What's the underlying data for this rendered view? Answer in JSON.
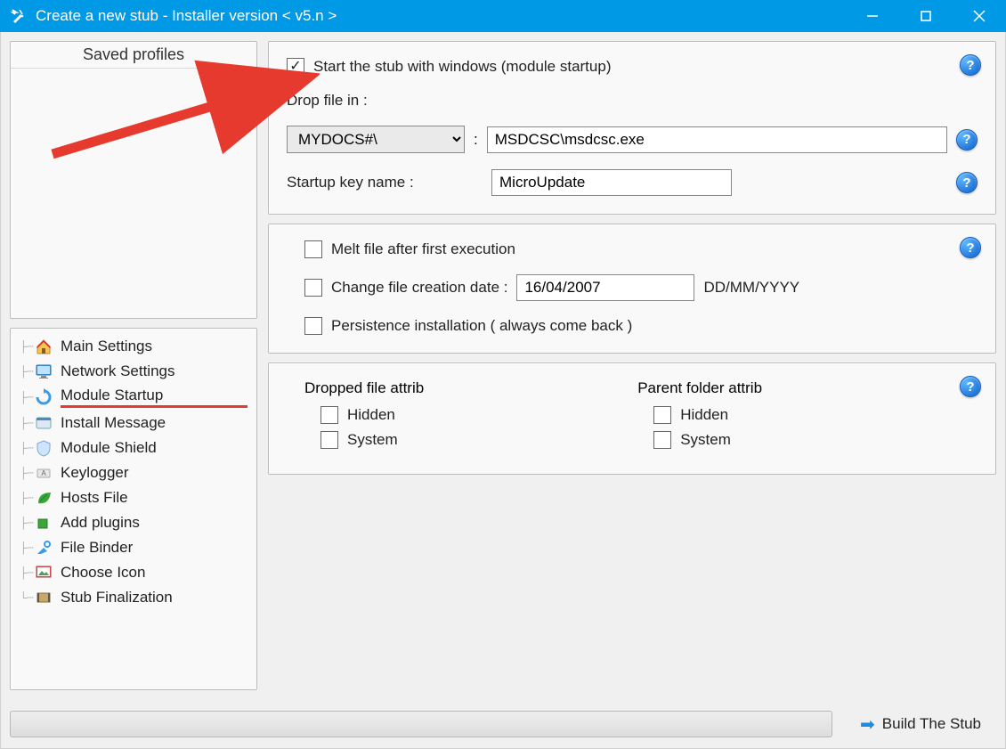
{
  "window": {
    "title": "Create a new stub - Installer version < v5.n >"
  },
  "left": {
    "saved_profiles_label": "Saved profiles",
    "nav": [
      {
        "label": "Main Settings",
        "icon": "home-icon",
        "active": false
      },
      {
        "label": "Network Settings",
        "icon": "monitor-icon",
        "active": false
      },
      {
        "label": "Module Startup",
        "icon": "refresh-icon",
        "active": true
      },
      {
        "label": "Install Message",
        "icon": "message-icon",
        "active": false
      },
      {
        "label": "Module Shield",
        "icon": "shield-icon",
        "active": false
      },
      {
        "label": "Keylogger",
        "icon": "key-icon",
        "active": false
      },
      {
        "label": "Hosts File",
        "icon": "leaf-icon",
        "active": false
      },
      {
        "label": "Add plugins",
        "icon": "puzzle-icon",
        "active": false
      },
      {
        "label": "File Binder",
        "icon": "tool-icon",
        "active": false
      },
      {
        "label": "Choose Icon",
        "icon": "image-icon",
        "active": false
      },
      {
        "label": "Stub Finalization",
        "icon": "film-icon",
        "active": false
      }
    ]
  },
  "group1": {
    "start_with_windows_label": "Start the stub with windows (module startup)",
    "start_with_windows_checked": true,
    "drop_file_in_label": "Drop file in :",
    "drop_folder_selected": "MYDOCS#\\",
    "separator": ":",
    "drop_path": "MSDCSC\\msdcsc.exe",
    "startup_key_label": "Startup key name :",
    "startup_key_value": "MicroUpdate"
  },
  "group2": {
    "melt_label": "Melt file after first execution",
    "change_date_label": "Change file creation date :",
    "change_date_value": "16/04/2007",
    "date_format_hint": "DD/MM/YYYY",
    "persistence_label": "Persistence installation ( always come back )"
  },
  "group3": {
    "dropped_attrib_title": "Dropped file attrib",
    "parent_attrib_title": "Parent folder attrib",
    "hidden_label": "Hidden",
    "system_label": "System"
  },
  "bottom": {
    "build_label": "Build The Stub"
  }
}
